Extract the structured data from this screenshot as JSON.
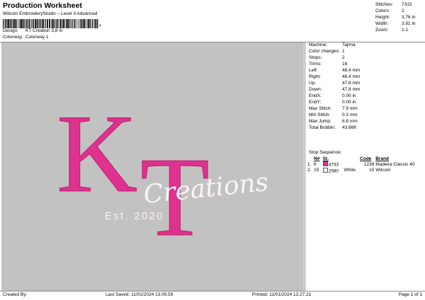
{
  "header": {
    "title": "Production Worksheet",
    "subtitle": "Wilcom EmbroideryStudio – Level 3 Advanced",
    "barcode_suffix": ","
  },
  "meta": {
    "design_label": "Design:",
    "design_value": "KT Creation 3,8 in",
    "colorway_label": "Colorway:",
    "colorway_value": "Colorway 1"
  },
  "stats": [
    {
      "label": "Stitches:",
      "value": "7315"
    },
    {
      "label": "Colors:",
      "value": "2"
    },
    {
      "label": "Height:",
      "value": "3.76 in"
    },
    {
      "label": "Width:",
      "value": "3.81 in"
    },
    {
      "label": "Zoom:",
      "value": "1:1"
    }
  ],
  "machine_info": [
    {
      "label": "Machine:",
      "value": "Tajima"
    },
    {
      "label": "Color changes:",
      "value": "1"
    },
    {
      "label": "Stops:",
      "value": "2"
    },
    {
      "label": "Trims:",
      "value": "16"
    },
    {
      "label": "Left:",
      "value": "48.4 mm"
    },
    {
      "label": "Right:",
      "value": "48.4 mm"
    },
    {
      "label": "Up:",
      "value": "47.8 mm"
    },
    {
      "label": "Down:",
      "value": "47.8 mm"
    },
    {
      "label": "EndX:",
      "value": "0.00 in"
    },
    {
      "label": "EndY:",
      "value": "0.00 in"
    },
    {
      "label": "Max Stitch:",
      "value": "7.9 mm"
    },
    {
      "label": "Min Stitch:",
      "value": "0.3 mm"
    },
    {
      "label": "Max Jump:",
      "value": "6.8 mm"
    },
    {
      "label": "Total Bobbin:",
      "value": "43.66ft"
    }
  ],
  "stop_sequence": {
    "title": "Stop Sequence:",
    "headers": {
      "n": "N#",
      "st": "St.",
      "code": "Code",
      "brand": "Brand"
    },
    "rows": [
      {
        "index": "1.",
        "n": "6",
        "color": "#e0338f",
        "st": "4733",
        "code": "1238",
        "brand": "Madeira Classic 40"
      },
      {
        "index": "2.",
        "n": "15",
        "color": "#ffffff",
        "st": "2580",
        "name": "White",
        "code": "15",
        "brand": "Wilcom"
      }
    ]
  },
  "artwork": {
    "letters_top": "K",
    "letters_t": "T",
    "script": "Creations",
    "est": "Est. 2020",
    "pink": "#e0338f",
    "pink_dark": "#b81c6e",
    "white": "#fbf4f7"
  },
  "footer": {
    "created_by": "Created By:",
    "last_saved": "Last Saved: 11/01/2024 13.09.59",
    "printed": "Printed: 11/01/2024 13.27.21",
    "page": "Page 1 of 1"
  }
}
